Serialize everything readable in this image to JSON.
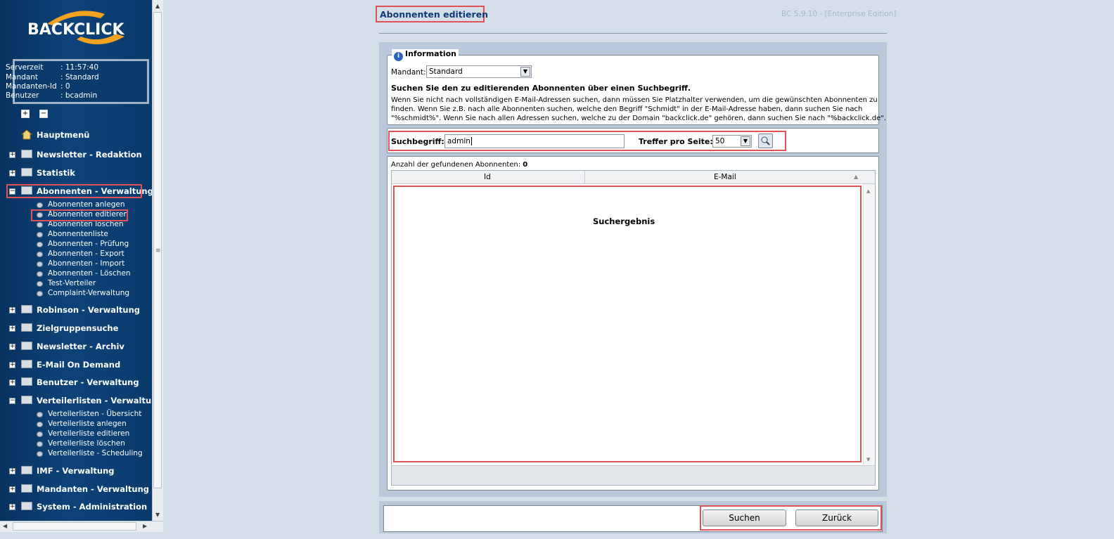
{
  "app": {
    "logo_text": "BACKCLICK",
    "version": "BC 5.9.10 - [Enterprise Edition]"
  },
  "server_info": [
    {
      "key": "Serverzeit",
      "value": ": 11:57:40"
    },
    {
      "key": "Mandant",
      "value": ": Standard"
    },
    {
      "key": "Mandanten-Id",
      "value": ": 0"
    },
    {
      "key": "Benutzer",
      "value": ": bcadmin"
    }
  ],
  "tree_tools": {
    "expand": "+",
    "collapse": "−"
  },
  "nav": {
    "home": "Hauptmenü",
    "sections": [
      {
        "label": "Newsletter - Redaktion",
        "expanded": false
      },
      {
        "label": "Statistik",
        "expanded": false
      },
      {
        "label": "Abonnenten - Verwaltung",
        "expanded": true
      },
      {
        "label": "Robinson - Verwaltung",
        "expanded": false
      },
      {
        "label": "Zielgruppensuche",
        "expanded": false
      },
      {
        "label": "Newsletter - Archiv",
        "expanded": false
      },
      {
        "label": "E-Mail On Demand",
        "expanded": false
      },
      {
        "label": "Benutzer - Verwaltung",
        "expanded": false
      },
      {
        "label": "Verteilerlisten - Verwaltung",
        "expanded": true
      },
      {
        "label": "IMF - Verwaltung",
        "expanded": false
      },
      {
        "label": "Mandanten - Verwaltung",
        "expanded": false
      },
      {
        "label": "System - Administration",
        "expanded": false
      }
    ],
    "abonnenten_items": [
      "Abonnenten anlegen",
      "Abonnenten editieren",
      "Abonnenten löschen",
      "Abonnentenliste",
      "Abonnenten - Prüfung",
      "Abonnenten - Export",
      "Abonnenten - Import",
      "Abonnenten - Löschen",
      "Test-Verteiler",
      "Complaint-Verwaltung"
    ],
    "verteiler_items": [
      "Verteilerlisten - Übersicht",
      "Verteilerliste anlegen",
      "Verteilerliste editieren",
      "Verteilerliste löschen",
      "Verteilerliste - Scheduling"
    ]
  },
  "page": {
    "title": "Abonnenten editieren",
    "info_legend": "Information",
    "info_icon": "i",
    "mandant_label": "Mandant:",
    "mandant_value": "Standard",
    "instruction_heading": "Suchen Sie den zu editierenden Abonnenten über einen Suchbegriff.",
    "instruction_lines": [
      "Wenn Sie nicht nach vollständigen E-Mail-Adressen suchen, dann müssen Sie Platzhalter verwenden, um die gewünschten Abonnenten zu",
      "finden. Wenn Sie z.B. nach alle Abonnenten suchen, welche den Begriff \"Schmidt\" in der E-Mail-Adresse haben, dann suchen Sie nach",
      "\"%schmidt%\". Wenn Sie nach allen Adressen suchen, welche zu der Domain \"backclick.de\" gehören, dann suchen Sie nach \"%backclick.de\"."
    ],
    "search_label": "Suchbegriff:",
    "search_value": "admin",
    "per_page_label": "Treffer pro Seite:",
    "per_page_value": "50",
    "found_label": "Anzahl der gefundenen Abonnenten:",
    "found_count": "0",
    "columns": [
      "Id",
      "E-Mail"
    ],
    "result_label": "Suchergebnis",
    "btn_search": "Suchen",
    "btn_back": "Zurück"
  },
  "colors": {
    "sidebar": "#0d4379",
    "highlight": "#e05256",
    "title": "#0e3a78"
  }
}
